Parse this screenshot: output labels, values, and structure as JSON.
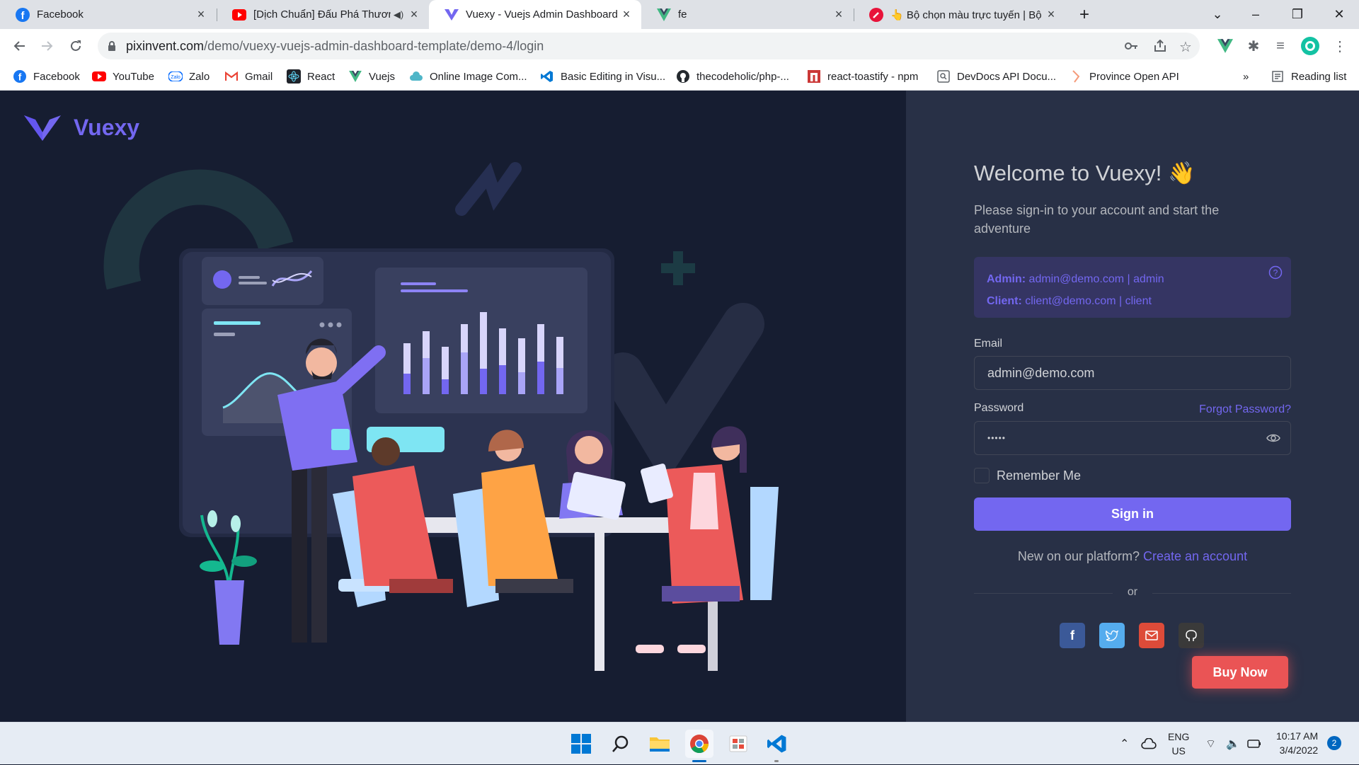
{
  "browser": {
    "tabs": [
      {
        "title": "Facebook",
        "icon": "facebook-icon"
      },
      {
        "title": "[Dịch Chuẩn] Đấu Phá Thương",
        "icon": "youtube-icon"
      },
      {
        "title": "Vuexy - Vuejs Admin Dashboard",
        "icon": "vuexy-icon"
      },
      {
        "title": "fe",
        "icon": "vue-icon"
      },
      {
        "title": "👆 Bộ chọn màu trực tuyến | Bộ",
        "icon": "picker-icon"
      }
    ],
    "url_host": "pixinvent.com",
    "url_path": "/demo/vuexy-vuejs-admin-dashboard-template/demo-4/login",
    "bookmarks": [
      {
        "label": "Facebook",
        "icon": "facebook-icon"
      },
      {
        "label": "YouTube",
        "icon": "youtube-icon"
      },
      {
        "label": "Zalo",
        "icon": "zalo-icon"
      },
      {
        "label": "Gmail",
        "icon": "gmail-icon"
      },
      {
        "label": "React",
        "icon": "react-icon"
      },
      {
        "label": "Vuejs",
        "icon": "vue-icon"
      },
      {
        "label": "Online Image Com...",
        "icon": "cloud-icon"
      },
      {
        "label": "Basic Editing in Visu...",
        "icon": "vscode-icon"
      },
      {
        "label": "thecodeholic/php-...",
        "icon": "github-icon"
      },
      {
        "label": "react-toastify - npm",
        "icon": "npm-icon"
      },
      {
        "label": "DevDocs API Docu...",
        "icon": "devdocs-icon"
      },
      {
        "label": "Province Open API",
        "icon": "api-icon"
      }
    ],
    "more": "»",
    "reading_list": "Reading list"
  },
  "login": {
    "brand": "Vuexy",
    "title": "Welcome to Vuexy! 👋",
    "subtitle": "Please sign-in to your account and start the adventure",
    "admin_label": "Admin:",
    "admin_value": " admin@demo.com | admin",
    "client_label": "Client:",
    "client_value": " client@demo.com | client",
    "email_label": "Email",
    "email_value": "admin@demo.com",
    "password_label": "Password",
    "password_value": "•••••",
    "forgot": "Forgot Password?",
    "remember": "Remember Me",
    "signin": "Sign in",
    "new_text": "New on our platform? ",
    "create": "Create an account",
    "or": "or",
    "buy_now": "Buy Now"
  },
  "taskbar": {
    "lang_1": "ENG",
    "lang_2": "US",
    "time": "10:17 AM",
    "date": "3/4/2022",
    "notifications": "2"
  },
  "colors": {
    "primary": "#7367f0",
    "page_bg": "#161d31",
    "card_bg": "#283046",
    "danger": "#ea5455"
  }
}
